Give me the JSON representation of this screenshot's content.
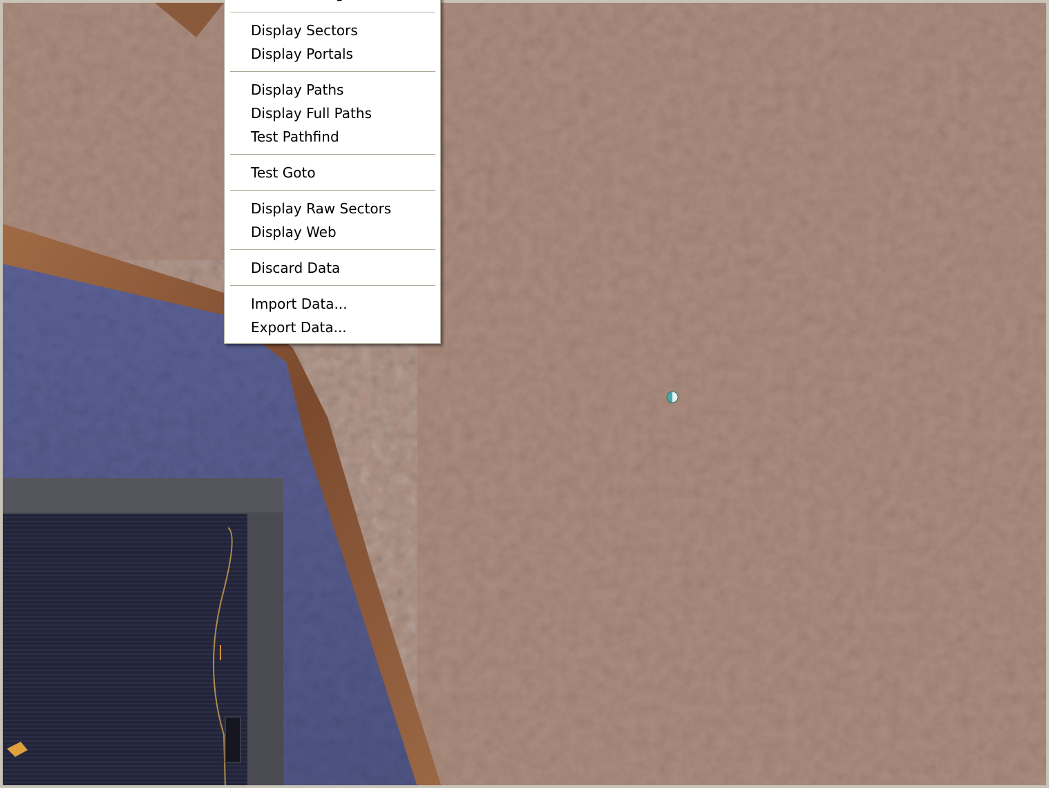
{
  "context_menu": {
    "items": [
      {
        "label": "Generate Flight Data...",
        "name": "menu-item-generate-flight-data",
        "clipped": true
      },
      {
        "separator": true
      },
      {
        "label": "Display Sectors",
        "name": "menu-item-display-sectors"
      },
      {
        "label": "Display Portals",
        "name": "menu-item-display-portals"
      },
      {
        "separator": true
      },
      {
        "label": "Display Paths",
        "name": "menu-item-display-paths"
      },
      {
        "label": "Display Full Paths",
        "name": "menu-item-display-full-paths"
      },
      {
        "label": "Test Pathfind",
        "name": "menu-item-test-pathfind"
      },
      {
        "separator": true
      },
      {
        "label": "Test Goto",
        "name": "menu-item-test-goto"
      },
      {
        "separator": true
      },
      {
        "label": "Display Raw Sectors",
        "name": "menu-item-display-raw-sectors"
      },
      {
        "label": "Display Web",
        "name": "menu-item-display-web"
      },
      {
        "separator": true
      },
      {
        "label": "Discard Data",
        "name": "menu-item-discard-data"
      },
      {
        "separator": true
      },
      {
        "label": "Import Data...",
        "name": "menu-item-import-data"
      },
      {
        "label": "Export Data...",
        "name": "menu-item-export-data"
      }
    ]
  },
  "colors": {
    "terrain": "#a98b7d",
    "floor": "#5a5f8e",
    "wall_wood": "#8a5a3c",
    "building_dark": "#1d1f2c",
    "menu_bg": "#ffffff",
    "menu_separator": "#aca899"
  },
  "icons": {
    "cursor": "pathfind-target-marker-icon"
  }
}
